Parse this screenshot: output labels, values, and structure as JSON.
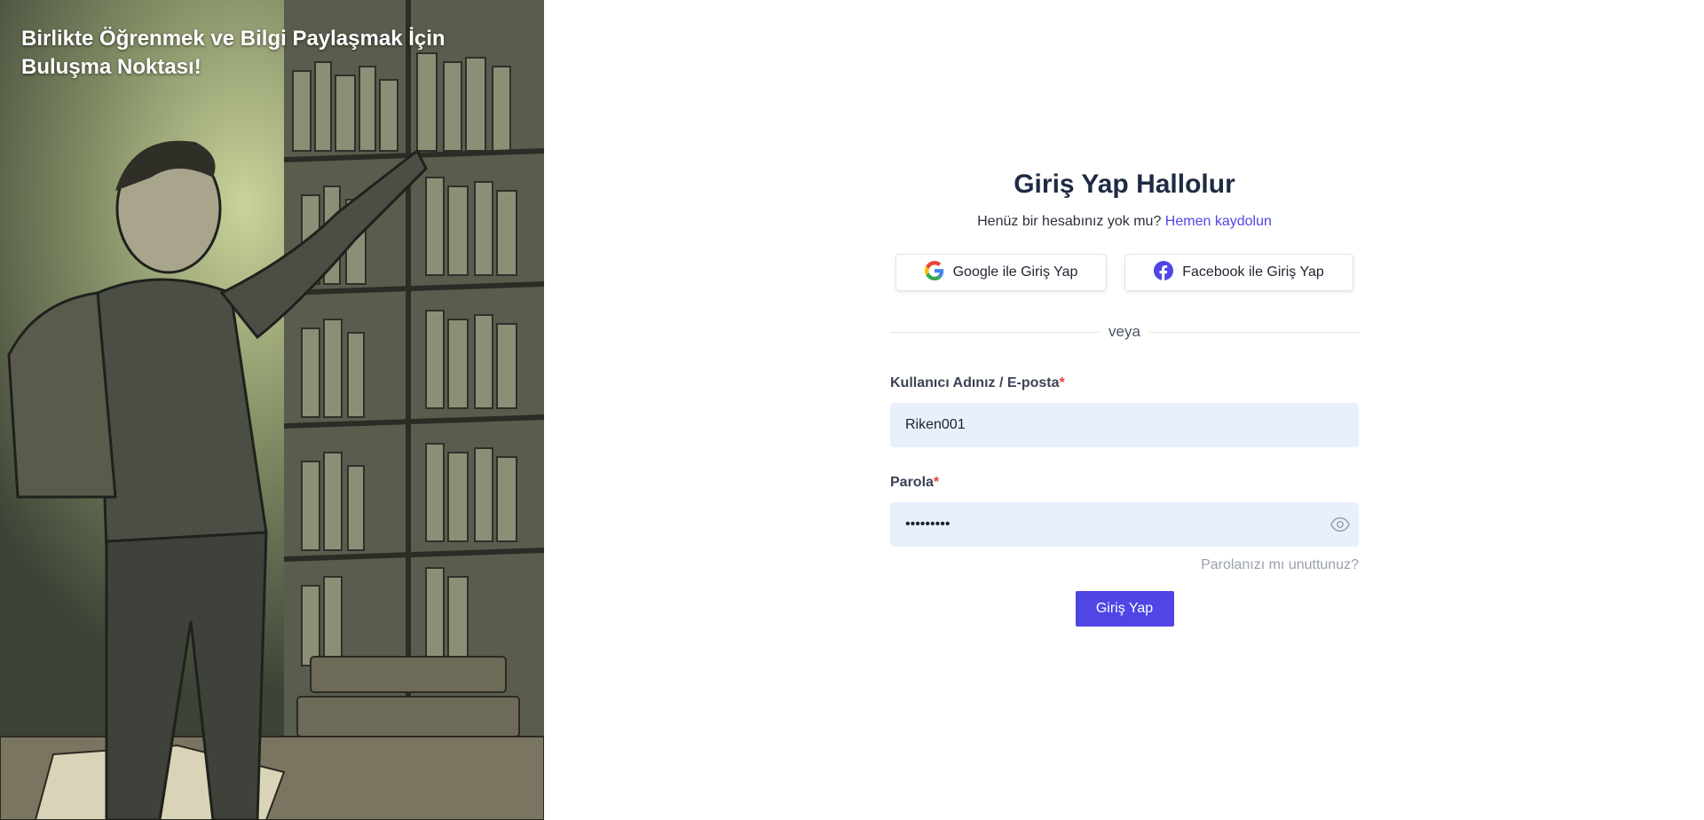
{
  "hero": {
    "text": "Birlikte Öğrenmek ve Bilgi Paylaşmak İçin Buluşma Noktası!"
  },
  "login": {
    "title": "Giriş Yap Hallolur",
    "no_account_text": "Henüz bir hesabınız yok mu?",
    "register_link": "Hemen kaydolun",
    "google_label": "Google ile Giriş Yap",
    "facebook_label": "Facebook ile Giriş Yap",
    "divider_text": "veya",
    "username_label": "Kullanıcı Adınız / E-posta",
    "username_value": "Riken001",
    "password_label": "Parola",
    "password_value": "•••••••••",
    "required_marker": "*",
    "forgot_link": "Parolanızı mı unuttunuz?",
    "submit_label": "Giriş Yap"
  },
  "icons": {
    "google": "google-icon",
    "facebook": "facebook-icon",
    "eye": "eye-icon"
  },
  "colors": {
    "accent": "#4f46e5",
    "title": "#1f2a44",
    "input_bg": "#e8f0fe",
    "required": "#e53e3e",
    "facebook": "#4f46e5"
  }
}
